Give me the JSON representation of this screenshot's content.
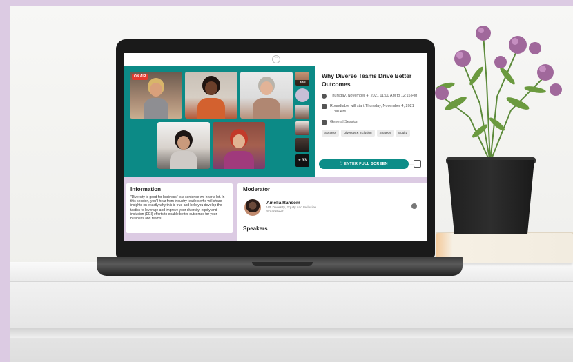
{
  "session": {
    "title": "Why Diverse Teams Drive Better Outcomes",
    "date": "Thursday, November 4, 2021 11:00 AM to 12:15 PM",
    "roundtable": "Roundtable will start Thursday, November 4, 2021 11:00 AM",
    "type": "General Session",
    "tags": [
      "Success",
      "Diversity & Inclusion",
      "Strategy",
      "Equity"
    ],
    "fullscreen_label": "ENTER FULL SCREEN"
  },
  "stage": {
    "live_badge": "ON AIR",
    "you_label": "You",
    "more_count": "+ 33"
  },
  "info": {
    "heading": "Information",
    "text": "\"Diversity is good for business\" is a sentence we hear a lot. In this session, you'll hear from industry leaders who will share insights on exactly why this is true and help you develop the tactics to leverage and improve your diversity, equity and inclusion (DEI) efforts to enable better outcomes for your business and teams."
  },
  "moderator": {
    "heading": "Moderator",
    "name": "Amelia Ransom",
    "role": "VP, Diversity, Equity and Inclusion",
    "org": "Smartsheet"
  },
  "speakers": {
    "heading": "Speakers"
  },
  "colors": {
    "stage_teal": "#0c8a86",
    "accent_lavender": "#dccbe3",
    "button_teal": "#0d8d88",
    "live_red": "#e53b2f"
  },
  "icons": {
    "collapse": "chevron-up-icon",
    "date": "clock-icon",
    "roundtable": "roundtable-icon",
    "type": "session-type-icon",
    "fullscreen": "fullscreen-icon",
    "calendar": "add-to-calendar-icon",
    "moderator_action": "user-icon"
  }
}
